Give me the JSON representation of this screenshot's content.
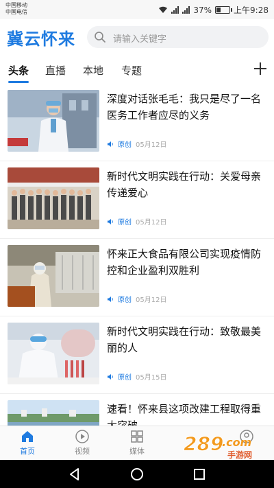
{
  "status_bar": {
    "carrier_1": "中国移动",
    "carrier_2": "中国电信",
    "battery_percent": "37%",
    "battery_level": 0.37,
    "time": "上午9:28"
  },
  "header": {
    "app_title": "冀云怀来",
    "search_placeholder": "请输入关键字"
  },
  "tabs": [
    {
      "label": "头条",
      "active": true
    },
    {
      "label": "直播",
      "active": false
    },
    {
      "label": "本地",
      "active": false
    },
    {
      "label": "专题",
      "active": false
    }
  ],
  "news": [
    {
      "title": "深度对话张毛毛：我只是尽了一名医务工作者应尽的义务",
      "tag": "原创",
      "date": "05月12日"
    },
    {
      "title": "新时代文明实践在行动：关爱母亲 传递爱心",
      "tag": "原创",
      "date": "05月12日"
    },
    {
      "title": "怀来正大食品有限公司实现疫情防控和企业盈利双胜利",
      "tag": "原创",
      "date": "05月12日"
    },
    {
      "title": "新时代文明实践在行动：致敬最美丽的人",
      "tag": "原创",
      "date": "05月15日"
    },
    {
      "title": "速看！怀来县这项改建工程取得重大突破",
      "tag": "",
      "date": ""
    }
  ],
  "bottom_nav": [
    {
      "label": "首页",
      "icon": "home-icon",
      "active": true
    },
    {
      "label": "视频",
      "icon": "play-icon",
      "active": false
    },
    {
      "label": "媒体",
      "icon": "grid-icon",
      "active": false
    },
    {
      "label": "",
      "icon": "profile-icon",
      "active": false
    }
  ],
  "watermark": {
    "text": "289.com",
    "sub": "手游网"
  },
  "colors": {
    "accent": "#1f7be0",
    "watermark_orange": "#f39a1e"
  }
}
